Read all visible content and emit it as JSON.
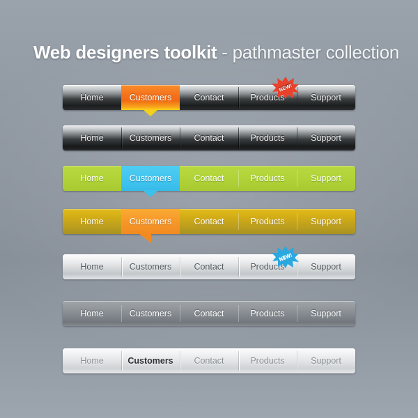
{
  "title": {
    "strong": "Web designers toolkit",
    "light": " - pathmaster collection"
  },
  "colors": {
    "background": "#8f97a1",
    "orange_active": "#f4701a",
    "yellow_tip": "#f6cf1c",
    "green": "#b2d439",
    "blue_active": "#41c4ef",
    "gold": "#d4ae17",
    "orange_gold_active": "#f7992a",
    "silver_light": "#e2e4e6",
    "gray_mid": "#80868b",
    "badge_red": "#e8422c",
    "badge_blue": "#2aa8e0",
    "dark_chrome": "#1b1d1e"
  },
  "badge": {
    "label": "NEW!"
  },
  "navbars": [
    {
      "style_name": "dark-chrome-orange",
      "items": [
        {
          "label": "Home",
          "active": false,
          "badge": null
        },
        {
          "label": "Customers",
          "active": true,
          "badge": null
        },
        {
          "label": "Contact",
          "active": false,
          "badge": null
        },
        {
          "label": "Products",
          "active": false,
          "badge": "NEW!"
        },
        {
          "label": "Support",
          "active": false,
          "badge": null
        }
      ]
    },
    {
      "style_name": "dark-chrome-plain",
      "items": [
        {
          "label": "Home",
          "active": false,
          "badge": null
        },
        {
          "label": "Customers",
          "active": false,
          "badge": null
        },
        {
          "label": "Contact",
          "active": false,
          "badge": null
        },
        {
          "label": "Products",
          "active": false,
          "badge": null
        },
        {
          "label": "Support",
          "active": false,
          "badge": null
        }
      ]
    },
    {
      "style_name": "green-blue-active",
      "items": [
        {
          "label": "Home",
          "active": false,
          "badge": null
        },
        {
          "label": "Customers",
          "active": true,
          "badge": null
        },
        {
          "label": "Contact",
          "active": false,
          "badge": null
        },
        {
          "label": "Products",
          "active": false,
          "badge": null
        },
        {
          "label": "Support",
          "active": false,
          "badge": null
        }
      ]
    },
    {
      "style_name": "gold-orange-active",
      "items": [
        {
          "label": "Home",
          "active": false,
          "badge": null
        },
        {
          "label": "Customers",
          "active": true,
          "badge": null
        },
        {
          "label": "Contact",
          "active": false,
          "badge": null
        },
        {
          "label": "Products",
          "active": false,
          "badge": null
        },
        {
          "label": "Support",
          "active": false,
          "badge": null
        }
      ]
    },
    {
      "style_name": "light-silver-blue-badge",
      "items": [
        {
          "label": "Home",
          "active": false,
          "badge": null
        },
        {
          "label": "Customers",
          "active": false,
          "badge": null
        },
        {
          "label": "Contact",
          "active": false,
          "badge": null
        },
        {
          "label": "Products",
          "active": false,
          "badge": "NEW!"
        },
        {
          "label": "Support",
          "active": false,
          "badge": null
        }
      ]
    },
    {
      "style_name": "gray-mid",
      "items": [
        {
          "label": "Home",
          "active": false,
          "badge": null
        },
        {
          "label": "Customers",
          "active": false,
          "badge": null
        },
        {
          "label": "Contact",
          "active": false,
          "badge": null
        },
        {
          "label": "Products",
          "active": false,
          "badge": null
        },
        {
          "label": "Support",
          "active": false,
          "badge": null
        }
      ]
    },
    {
      "style_name": "light-silver-bold-active",
      "items": [
        {
          "label": "Home",
          "active": false,
          "badge": null
        },
        {
          "label": "Customers",
          "active": true,
          "badge": null
        },
        {
          "label": "Contact",
          "active": false,
          "badge": null
        },
        {
          "label": "Products",
          "active": false,
          "badge": null
        },
        {
          "label": "Support",
          "active": false,
          "badge": null
        }
      ]
    }
  ]
}
